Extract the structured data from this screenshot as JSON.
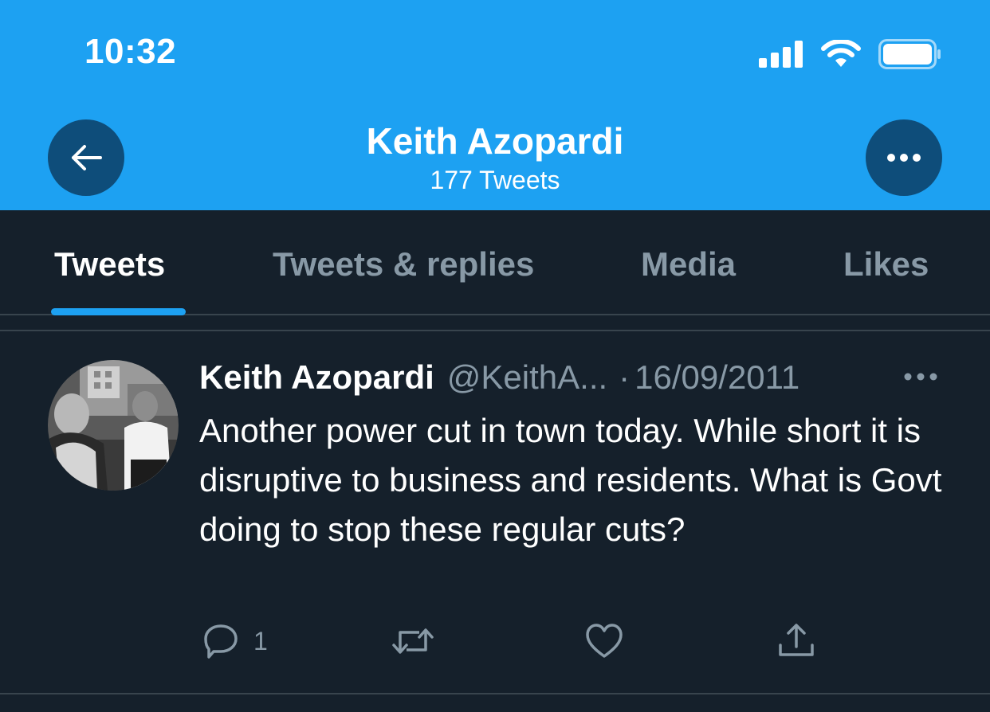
{
  "status_bar": {
    "time": "10:32",
    "icons": [
      "signal-icon",
      "wifi-icon",
      "battery-icon"
    ]
  },
  "header": {
    "back_icon": "arrow-left-icon",
    "title": "Keith Azopardi",
    "subtitle": "177 Tweets",
    "more_icon": "more-horizontal-icon"
  },
  "tabs": [
    {
      "label": "Tweets",
      "active": true
    },
    {
      "label": "Tweets & replies",
      "active": false
    },
    {
      "label": "Media",
      "active": false
    },
    {
      "label": "Likes",
      "active": false
    }
  ],
  "tweet": {
    "author_name": "Keith Azopardi",
    "handle": "@KeithA...",
    "separator": "·",
    "date": "16/09/2011",
    "text": "Another power cut in town today. While short it is disruptive to business and residents. What is Govt doing to stop these regular cuts?",
    "reply_count": "1",
    "action_icons": [
      "reply-icon",
      "retweet-icon",
      "like-icon",
      "share-icon"
    ]
  },
  "colors": {
    "header_bg": "#1da1f2",
    "body_bg": "#15202b",
    "muted_text": "#8899a6",
    "divider": "#38444d",
    "nav_button_bg": "#0e4d7a"
  }
}
